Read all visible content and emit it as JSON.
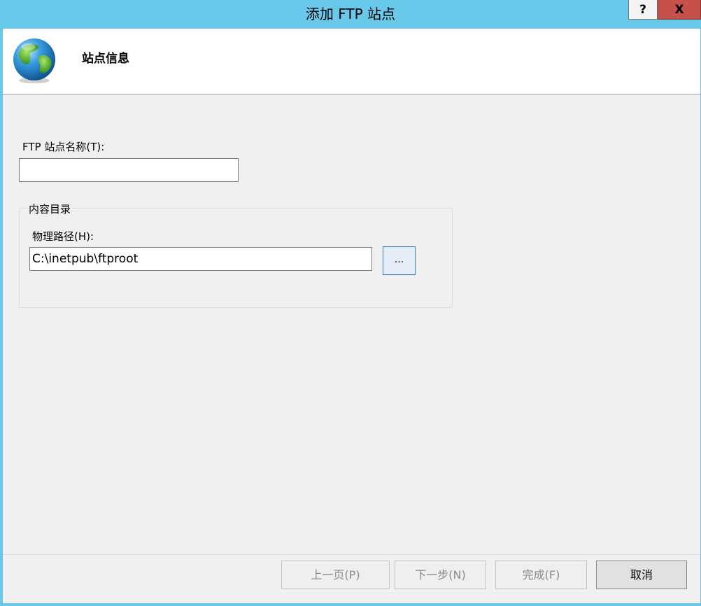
{
  "window": {
    "title": "添加 FTP 站点",
    "help_label": "?",
    "close_label": "X"
  },
  "header": {
    "title": "站点信息",
    "icon": "globe-icon"
  },
  "form": {
    "site_name_label": "FTP 站点名称(T):",
    "site_name_value": "",
    "content_dir_group": "内容目录",
    "physical_path_label": "物理路径(H):",
    "physical_path_value": "C:\\inetpub\\ftproot",
    "browse_label": "..."
  },
  "buttons": {
    "prev": "上一页(P)",
    "next": "下一步(N)",
    "finish": "完成(F)",
    "cancel": "取消"
  },
  "colors": {
    "title_bar": "#69c9eb",
    "close_button": "#c7504a"
  }
}
